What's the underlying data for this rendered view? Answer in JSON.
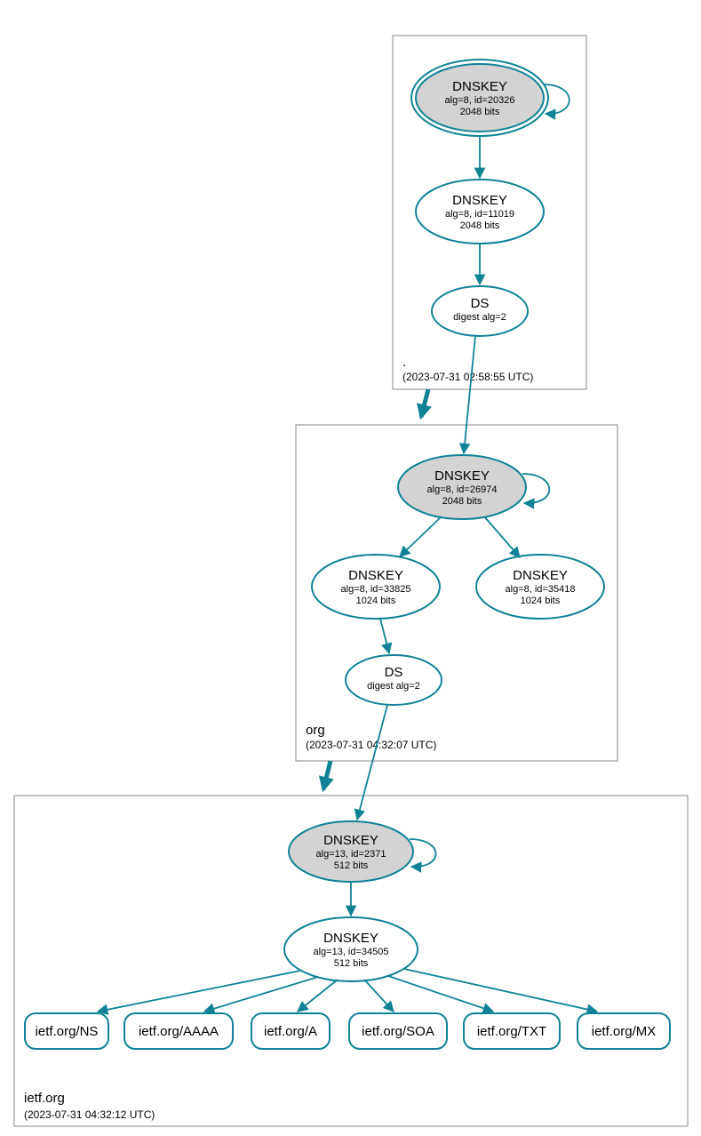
{
  "colors": {
    "stroke": "#0f8395",
    "fill_ksk": "#d3d3d3",
    "box": "#888888"
  },
  "zones": [
    {
      "name": ".",
      "timestamp": "(2023-07-31 02:58:55 UTC)",
      "nodes": [
        {
          "id": "root-ksk",
          "title": "DNSKEY",
          "sub1": "alg=8, id=20326",
          "sub2": "2048 bits",
          "filled": true,
          "double_border": true
        },
        {
          "id": "root-zsk",
          "title": "DNSKEY",
          "sub1": "alg=8, id=11019",
          "sub2": "2048 bits",
          "filled": false,
          "double_border": false
        },
        {
          "id": "root-ds",
          "title": "DS",
          "sub1": "digest alg=2",
          "sub2": "",
          "filled": false,
          "double_border": false
        }
      ]
    },
    {
      "name": "org",
      "timestamp": "(2023-07-31 04:32:07 UTC)",
      "nodes": [
        {
          "id": "org-ksk",
          "title": "DNSKEY",
          "sub1": "alg=8, id=26974",
          "sub2": "2048 bits",
          "filled": true,
          "double_border": false
        },
        {
          "id": "org-zsk1",
          "title": "DNSKEY",
          "sub1": "alg=8, id=33825",
          "sub2": "1024 bits",
          "filled": false,
          "double_border": false
        },
        {
          "id": "org-zsk2",
          "title": "DNSKEY",
          "sub1": "alg=8, id=35418",
          "sub2": "1024 bits",
          "filled": false,
          "double_border": false
        },
        {
          "id": "org-ds",
          "title": "DS",
          "sub1": "digest alg=2",
          "sub2": "",
          "filled": false,
          "double_border": false
        }
      ]
    },
    {
      "name": "ietf.org",
      "timestamp": "(2023-07-31 04:32:12 UTC)",
      "nodes": [
        {
          "id": "ietf-ksk",
          "title": "DNSKEY",
          "sub1": "alg=13, id=2371",
          "sub2": "512 bits",
          "filled": true,
          "double_border": false
        },
        {
          "id": "ietf-zsk",
          "title": "DNSKEY",
          "sub1": "alg=13, id=34505",
          "sub2": "512 bits",
          "filled": false,
          "double_border": false
        }
      ],
      "rrsets": [
        {
          "id": "rr-ns",
          "label": "ietf.org/NS"
        },
        {
          "id": "rr-aaaa",
          "label": "ietf.org/AAAA"
        },
        {
          "id": "rr-a",
          "label": "ietf.org/A"
        },
        {
          "id": "rr-soa",
          "label": "ietf.org/SOA"
        },
        {
          "id": "rr-txt",
          "label": "ietf.org/TXT"
        },
        {
          "id": "rr-mx",
          "label": "ietf.org/MX"
        }
      ]
    }
  ],
  "edges_description": "root-ksk self-loop; root-ksk→root-zsk; root-zsk→root-ds; root-ds→org-ksk; zone-edge .→org; org-ksk self-loop; org-ksk→org-zsk1; org-ksk→org-zsk2; org-zsk1→org-ds; org-ds→ietf-ksk; zone-edge org→ietf.org; ietf-ksk self-loop; ietf-ksk→ietf-zsk; ietf-zsk→each rrset"
}
